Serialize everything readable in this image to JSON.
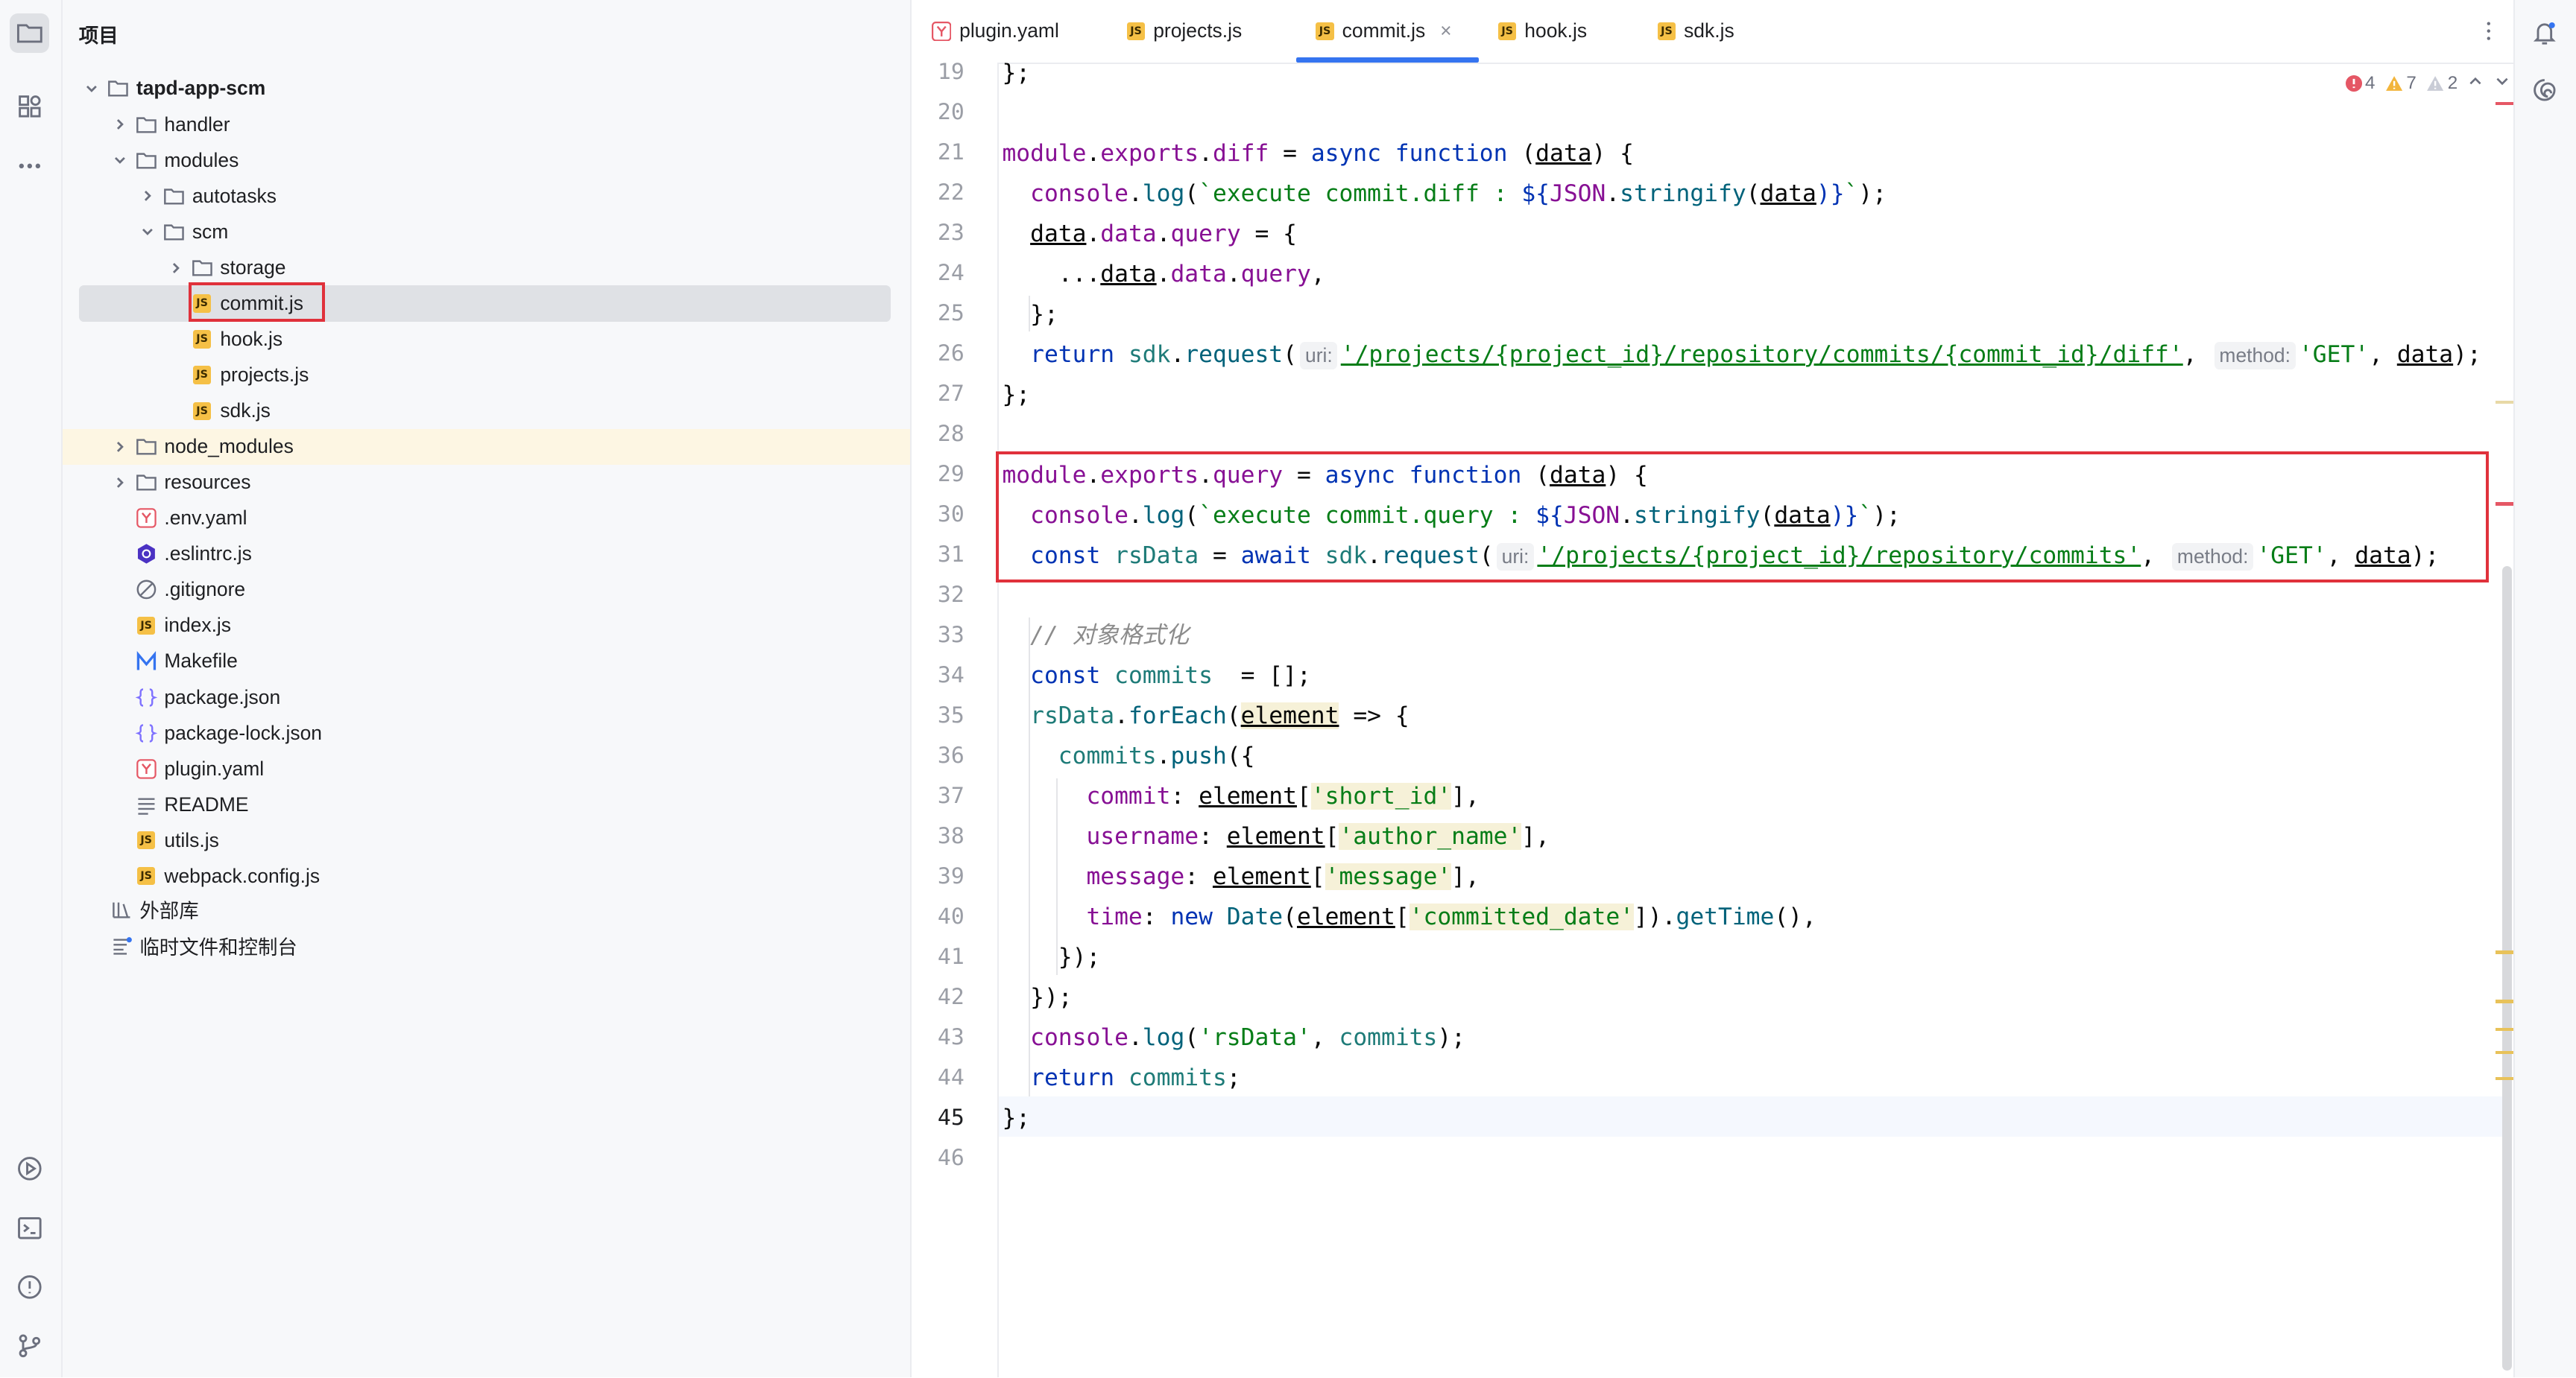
{
  "project": {
    "title": "项目",
    "root": "tapd-app-scm",
    "items": [
      {
        "label": "handler",
        "kind": "folder",
        "depth": 1,
        "state": "collapsed"
      },
      {
        "label": "modules",
        "kind": "folder",
        "depth": 1,
        "state": "expanded"
      },
      {
        "label": "autotasks",
        "kind": "folder",
        "depth": 2,
        "state": "collapsed"
      },
      {
        "label": "scm",
        "kind": "folder",
        "depth": 2,
        "state": "expanded"
      },
      {
        "label": "storage",
        "kind": "folder",
        "depth": 3,
        "state": "collapsed"
      },
      {
        "label": "commit.js",
        "kind": "js",
        "depth": 3,
        "selected": true
      },
      {
        "label": "hook.js",
        "kind": "js",
        "depth": 3
      },
      {
        "label": "projects.js",
        "kind": "js",
        "depth": 3
      },
      {
        "label": "sdk.js",
        "kind": "js",
        "depth": 3
      },
      {
        "label": "node_modules",
        "kind": "folder",
        "depth": 1,
        "state": "collapsed",
        "highlight": true
      },
      {
        "label": "resources",
        "kind": "folder",
        "depth": 1,
        "state": "collapsed"
      },
      {
        "label": ".env.yaml",
        "kind": "yaml",
        "depth": 1
      },
      {
        "label": ".eslintrc.js",
        "kind": "eslint",
        "depth": 1
      },
      {
        "label": ".gitignore",
        "kind": "ignore",
        "depth": 1
      },
      {
        "label": "index.js",
        "kind": "js",
        "depth": 1
      },
      {
        "label": "Makefile",
        "kind": "makefile",
        "depth": 1
      },
      {
        "label": "package.json",
        "kind": "json",
        "depth": 1
      },
      {
        "label": "package-lock.json",
        "kind": "json",
        "depth": 1
      },
      {
        "label": "plugin.yaml",
        "kind": "yaml",
        "depth": 1
      },
      {
        "label": "README",
        "kind": "text",
        "depth": 1
      },
      {
        "label": "utils.js",
        "kind": "js",
        "depth": 1
      },
      {
        "label": "webpack.config.js",
        "kind": "js",
        "depth": 1
      }
    ],
    "external": "外部库",
    "scratches": "临时文件和控制台"
  },
  "tabs": [
    {
      "label": "plugin.yaml",
      "kind": "yaml"
    },
    {
      "label": "projects.js",
      "kind": "js"
    },
    {
      "label": "commit.js",
      "kind": "js",
      "active": true
    },
    {
      "label": "hook.js",
      "kind": "js"
    },
    {
      "label": "sdk.js",
      "kind": "js"
    }
  ],
  "inspections": {
    "errors": "4",
    "warnings": "7",
    "weak_warnings": "2"
  },
  "hints": {
    "uri": "uri:",
    "method": "method:"
  },
  "editor": {
    "first_line": 19,
    "current_line": 45,
    "line_count": 28,
    "lines": {
      "l19a": "};",
      "l21a": "module",
      "l21b": ".",
      "l21c": "exports",
      "l21d": ".",
      "l21e": "diff",
      "l21f": " = ",
      "l21g": "async function",
      "l21h": " (",
      "l21i": "data",
      "l21j": ") {",
      "l22a": "console",
      "l22b": ".",
      "l22c": "log",
      "l22d": "(",
      "l22e": "`execute commit.diff : ",
      "l22f": "${",
      "l22g": "JSON",
      "l22h": ".",
      "l22i": "stringify",
      "l22j": "(",
      "l22k": "data",
      "l22l": ")}",
      "l22m": "`",
      "l22n": ");",
      "l23a": "data",
      "l23b": ".",
      "l23c": "data",
      "l23d": ".",
      "l23e": "query",
      "l23f": " = {",
      "l24a": "...",
      "l24b": "data",
      "l24c": ".",
      "l24d": "data",
      "l24e": ".",
      "l24f": "query",
      "l24g": ",",
      "l25a": "};",
      "l26a": "return ",
      "l26b": "sdk",
      "l26c": ".",
      "l26d": "request",
      "l26e": "(",
      "l26f": "'/projects/{project_id}/repository/commits/{commit_id}/diff'",
      "l26g": ", ",
      "l26h": "'GET'",
      "l26i": ", ",
      "l26j": "data",
      "l26k": ");",
      "l27a": "};",
      "l29a": "module",
      "l29b": ".",
      "l29c": "exports",
      "l29d": ".",
      "l29e": "query",
      "l29f": " = ",
      "l29g": "async function",
      "l29h": " (",
      "l29i": "data",
      "l29j": ") {",
      "l30a": "console",
      "l30b": ".",
      "l30c": "log",
      "l30d": "(",
      "l30e": "`execute commit.query : ",
      "l30f": "${",
      "l30g": "JSON",
      "l30h": ".",
      "l30i": "stringify",
      "l30j": "(",
      "l30k": "data",
      "l30l": ")}",
      "l30m": "`",
      "l30n": ");",
      "l31a": "const ",
      "l31b": "rsData",
      "l31c": " = ",
      "l31d": "await ",
      "l31e": "sdk",
      "l31f": ".",
      "l31g": "request",
      "l31h": "(",
      "l31i": "'/projects/{project_id}/repository/commits'",
      "l31j": ", ",
      "l31k": "'GET'",
      "l31l": ", ",
      "l31m": "data",
      "l31n": ");",
      "l33a": "// 对象格式化",
      "l34a": "const ",
      "l34b": "commits",
      "l34c": "  = [];",
      "l35a": "rsData",
      "l35b": ".",
      "l35c": "forEach",
      "l35d": "(",
      "l35e": "element",
      "l35f": " => {",
      "l36a": "commits",
      "l36b": ".",
      "l36c": "push",
      "l36d": "({",
      "l37a": "commit",
      "l37b": ": ",
      "l37c": "element",
      "l37d": "[",
      "l37e": "'short_id'",
      "l37f": "],",
      "l38a": "username",
      "l38b": ": ",
      "l38c": "element",
      "l38d": "[",
      "l38e": "'author_name'",
      "l38f": "],",
      "l39a": "message",
      "l39b": ": ",
      "l39c": "element",
      "l39d": "[",
      "l39e": "'message'",
      "l39f": "],",
      "l40a": "time",
      "l40b": ": ",
      "l40c": "new ",
      "l40d": "Date",
      "l40e": "(",
      "l40f": "element",
      "l40g": "[",
      "l40h": "'committed_date'",
      "l40i": "]).",
      "l40j": "getTime",
      "l40k": "(),",
      "l41a": "});",
      "l42a": "});",
      "l43a": "console",
      "l43b": ".",
      "l43c": "log",
      "l43d": "(",
      "l43e": "'rsData'",
      "l43f": ", ",
      "l43g": "commits",
      "l43h": ");",
      "l44a": "return ",
      "l44b": "commits",
      "l44c": ";",
      "l45a": "};"
    }
  },
  "colors": {
    "accent": "#3574f0",
    "error": "#e55765",
    "warning": "#f2b53c",
    "highlight_box": "#e0313b",
    "keyword": "#0033b3",
    "property": "#871094",
    "string": "#067d17",
    "function": "#00627a"
  }
}
